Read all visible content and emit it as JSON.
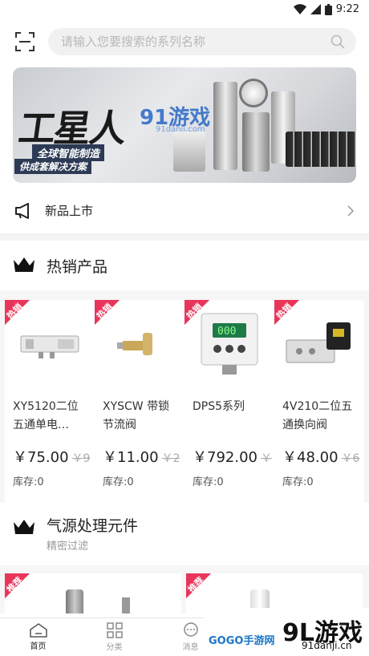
{
  "status_bar": {
    "time": "9:22"
  },
  "search": {
    "placeholder": "请输入您要搜索的系列名称"
  },
  "banner": {
    "headline": "工星人",
    "line1": "全球智能制造",
    "line2": "供成套解决方案",
    "watermark": "91游戏",
    "watermark_url": "91danji.com"
  },
  "new_arrivals": {
    "label": "新品上市"
  },
  "hot_section": {
    "title": "热销产品"
  },
  "badge_hot": "热销",
  "products": [
    {
      "name": "XY5120二位五通单电…",
      "price": "￥75.00",
      "old_price": "￥9",
      "stock": "库存:0"
    },
    {
      "name": "XYSCW 带锁节流阀",
      "price": "￥11.00",
      "old_price": "￥2",
      "stock": "库存:0"
    },
    {
      "name": "DPS5系列",
      "price": "￥792.00",
      "old_price": "￥",
      "stock": "库存:0"
    },
    {
      "name": "4V210二位五通换向阀",
      "price": "￥48.00",
      "old_price": "￥6",
      "stock": "库存:0"
    }
  ],
  "air_section": {
    "title": "气源处理元件",
    "subtitle": "精密过滤"
  },
  "badge_rec": "推荐",
  "tabs": [
    {
      "label": "首页",
      "icon": "home-icon"
    },
    {
      "label": "分类",
      "icon": "category-icon"
    },
    {
      "label": "消息",
      "icon": "message-icon"
    }
  ],
  "footer_logo": {
    "text": "9L游戏",
    "small": "GOGO手游网",
    "url": "91danji.cn"
  },
  "colors": {
    "badge": "#e8355a",
    "accent": "#222222"
  }
}
